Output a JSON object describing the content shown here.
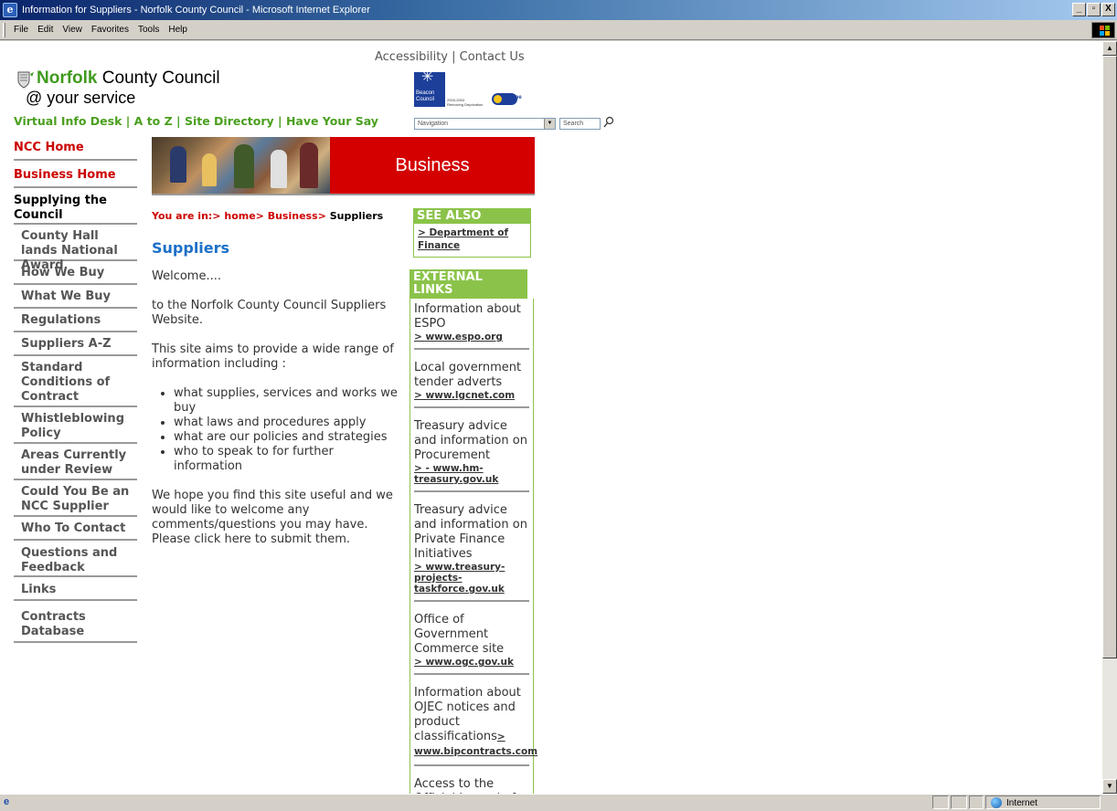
{
  "window": {
    "title": "Information for Suppliers - Norfolk County Council - Microsoft Internet Explorer",
    "minimize": "_",
    "maximize": "▫",
    "close": "X"
  },
  "menubar": {
    "items": [
      "File",
      "Edit",
      "View",
      "Favorites",
      "Tools",
      "Help"
    ]
  },
  "header": {
    "top_links": {
      "accessibility": "Accessibility",
      "separator": " | ",
      "contact": "Contact Us"
    },
    "logo": {
      "brand_bold": "Norfolk",
      "brand_rest": " County Council",
      "tagline": "@ your service"
    },
    "beacon": {
      "line1": "Beacon",
      "line2": "Council",
      "caption1": "2003-2004",
      "caption2": "Removing Deprivation"
    },
    "ukonline": "online",
    "nav": {
      "items": [
        "Virtual Info Desk",
        "A to Z",
        "Site Directory",
        "Have Your Say"
      ],
      "separator": " | "
    },
    "navigation_select": "Navigation",
    "search_placeholder": "Search"
  },
  "left_menu": [
    {
      "label": "NCC Home",
      "style": "red"
    },
    {
      "label": "Business Home",
      "style": "red"
    },
    {
      "label": "Supplying the Council",
      "style": "black"
    },
    {
      "label": "County Hall lands National Award",
      "style": "sub"
    },
    {
      "label": "How We Buy",
      "style": "sub"
    },
    {
      "label": "What We Buy",
      "style": "sub"
    },
    {
      "label": "Regulations",
      "style": "sub"
    },
    {
      "label": "Suppliers A-Z",
      "style": "sub"
    },
    {
      "label": "Standard Conditions of Contract",
      "style": "sub"
    },
    {
      "label": "Whistleblowing Policy",
      "style": "sub"
    },
    {
      "label": "Areas Currently under Review",
      "style": "sub"
    },
    {
      "label": "Could You Be an NCC Supplier",
      "style": "sub"
    },
    {
      "label": "Who To Contact",
      "style": "sub"
    },
    {
      "label": "Questions and Feedback",
      "style": "sub"
    },
    {
      "label": "Links",
      "style": "sub"
    },
    {
      "label": "Contracts Database",
      "style": "sub"
    }
  ],
  "banner": {
    "title": "Business"
  },
  "breadcrumb": {
    "prefix": "You are in:> ",
    "home": "home",
    "sep1": "> ",
    "business": "Business",
    "sep2": "> ",
    "current": "Suppliers"
  },
  "main": {
    "title": "Suppliers",
    "welcome": "Welcome....",
    "intro": "to the Norfolk County Council Suppliers Website.",
    "aims": "This site aims to provide a wide range of information including :",
    "bullets": [
      "what supplies, services and works we buy",
      "what laws and procedures apply",
      "what are our policies and strategies",
      "who to speak to for further information"
    ],
    "closing": "We hope you find this site useful and we would like to welcome any comments/questions you may have. Please click here to submit them."
  },
  "see_also": {
    "heading": "SEE ALSO",
    "link": "> Department of Finance"
  },
  "external_links": {
    "heading": "EXTERNAL LINKS",
    "items": [
      {
        "desc": "Information about ESPO",
        "link": "> www.espo.org"
      },
      {
        "desc": "Local government tender adverts",
        "link": "> www.lgcnet.com"
      },
      {
        "desc": "Treasury advice and information on Procurement",
        "link": "> - www.hm-treasury.gov.uk"
      },
      {
        "desc": "Treasury advice and information on Private Finance Initiatives",
        "link": "> www.treasury-projects-taskforce.gov.uk"
      },
      {
        "desc": "Office of Government Commerce site",
        "link": "> www.ogc.gov.uk"
      },
      {
        "desc": "Information about OJEC notices and product classifications",
        "link": "> www.bipcontracts.com"
      },
      {
        "desc": "Access to the Official Journal of the European",
        "link": ""
      }
    ]
  },
  "statusbar": {
    "zone": "Internet"
  }
}
